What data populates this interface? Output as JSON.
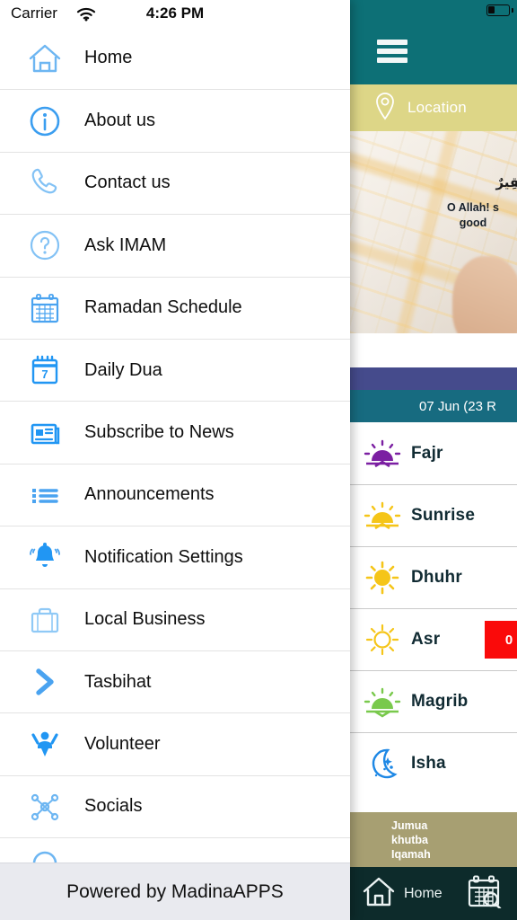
{
  "status_bar": {
    "carrier": "Carrier",
    "wifi_icon": "wifi-icon",
    "time": "4:26 PM",
    "battery_icon": "battery-low-icon"
  },
  "drawer": {
    "footer_text": "Powered by MadinaAPPS",
    "items": [
      {
        "label": "Home",
        "icon": "home-icon"
      },
      {
        "label": "About us",
        "icon": "info-circle-icon"
      },
      {
        "label": "Contact us",
        "icon": "phone-icon"
      },
      {
        "label": "Ask IMAM",
        "icon": "question-circle-icon"
      },
      {
        "label": "Ramadan Schedule",
        "icon": "calendar-grid-icon"
      },
      {
        "label": "Daily Dua",
        "icon": "calendar-day-icon"
      },
      {
        "label": "Subscribe to News",
        "icon": "newspaper-icon"
      },
      {
        "label": "Announcements",
        "icon": "list-icon"
      },
      {
        "label": "Notification Settings",
        "icon": "bell-icon"
      },
      {
        "label": "Local Business",
        "icon": "briefcase-icon"
      },
      {
        "label": "Tasbihat",
        "icon": "chevron-right-icon"
      },
      {
        "label": "Volunteer",
        "icon": "volunteer-person-icon"
      },
      {
        "label": "Socials",
        "icon": "share-network-icon"
      },
      {
        "label": "",
        "icon": "circle-icon"
      }
    ]
  },
  "app": {
    "menu_icon": "hamburger-menu-icon",
    "location": {
      "label": "Location",
      "icon": "map-pin-icon"
    },
    "banner": {
      "arabic": "خَيْرٍ فَقِيرٌ",
      "english_line1": "O Allah! s",
      "english_line2": "good"
    },
    "date_bar": {
      "text": "07 Jun (23 R"
    },
    "prayers": [
      {
        "name": "Fajr",
        "icon": "sunrise-purple-icon",
        "badge": ""
      },
      {
        "name": "Sunrise",
        "icon": "sunrise-yellow-icon",
        "badge": ""
      },
      {
        "name": "Dhuhr",
        "icon": "sun-icon",
        "badge": ""
      },
      {
        "name": "Asr",
        "icon": "sun-outline-icon",
        "badge": "0"
      },
      {
        "name": "Magrib",
        "icon": "sunset-green-icon",
        "badge": ""
      },
      {
        "name": "Isha",
        "icon": "moon-stars-icon",
        "badge": ""
      }
    ],
    "jumua": {
      "line1": "Jumua",
      "line2": "khutba",
      "line3": "Iqamah",
      "right_line1": "(",
      "right_line2": "("
    },
    "bottom_nav": [
      {
        "label": "Home",
        "icon": "home-outline-icon"
      },
      {
        "label": "",
        "icon": "calendar-search-icon"
      }
    ]
  },
  "colors": {
    "teal_header": "#0d7076",
    "khaki_location": "#ddd687",
    "purple_bar": "#454b8c",
    "date_bar_teal": "#176b80",
    "jumua_olive": "#a79f72",
    "bottom_nav_dark": "#0d2b2b",
    "badge_red": "#fa0a0a",
    "icon_blue": "#4aa3f0",
    "footer_grey": "#e9eaef"
  }
}
